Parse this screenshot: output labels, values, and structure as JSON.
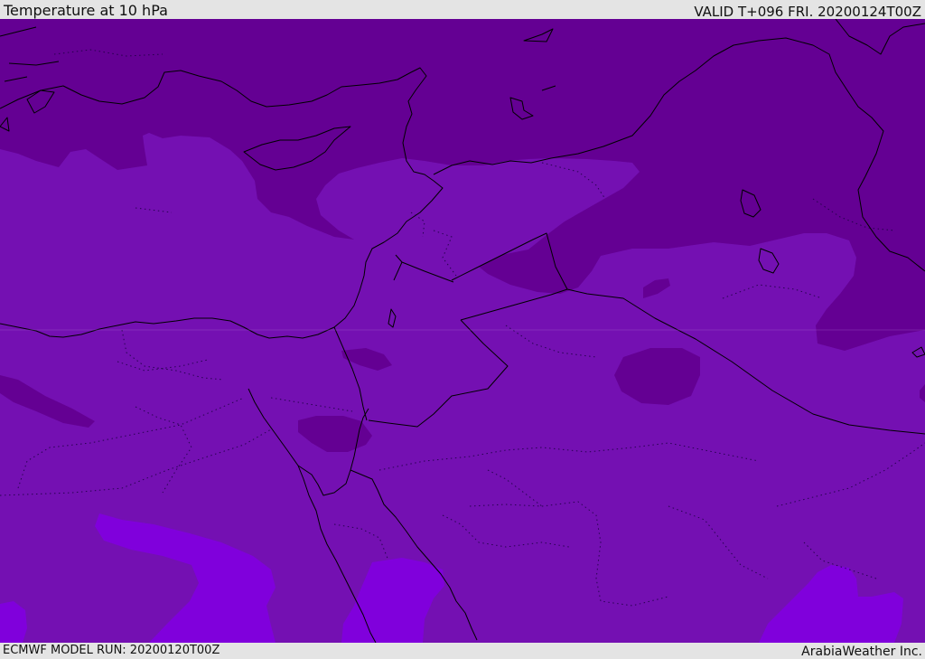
{
  "header": {
    "title": "Temperature at 10 hPa",
    "valid": "VALID T+096 FRI. 20200124T00Z"
  },
  "footer": {
    "model_run": "ECMWF MODEL RUN: 20200120T00Z",
    "credit": "ArabiaWeather Inc."
  },
  "map": {
    "variable": "Temperature",
    "level": "10 hPa",
    "colors": {
      "base_band": "#7410b2",
      "cold_band": "#640093",
      "warm_band": "#8000dc",
      "coastline": "#000000"
    }
  }
}
